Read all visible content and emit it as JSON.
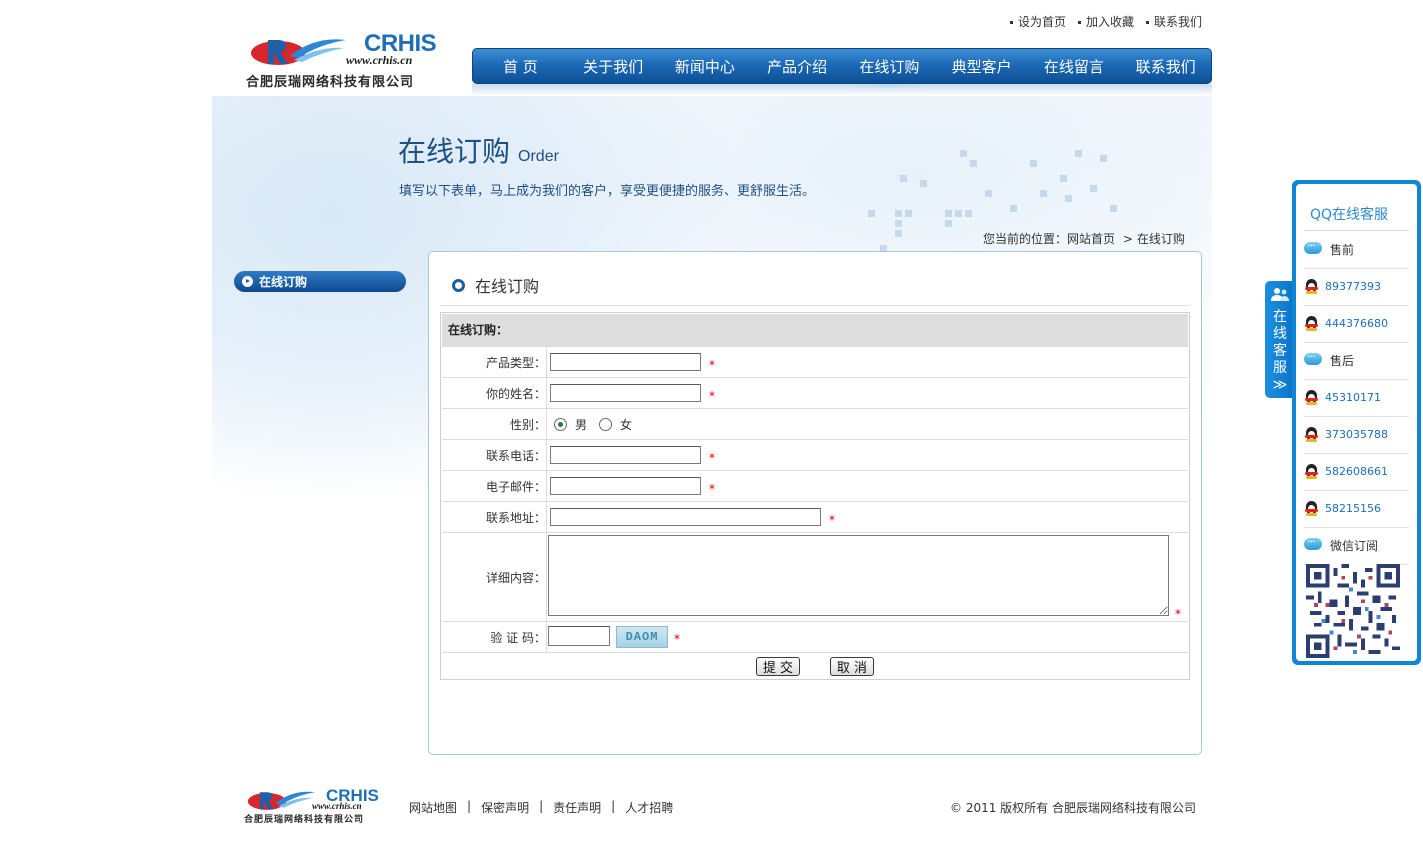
{
  "header": {
    "logo": {
      "brand": "CRHIS",
      "domain": "www.crhis.cn",
      "company": "合肥辰瑞网络科技有限公司"
    },
    "top_links": [
      "设为首页",
      "加入收藏",
      "联系我们"
    ],
    "nav": {
      "items": [
        "首 页",
        "关于我们",
        "新闻中心",
        "产品介绍",
        "在线订购",
        "典型客户",
        "在线留言",
        "联系我们"
      ],
      "active": "在线订购"
    }
  },
  "banner": {
    "title": "在线订购",
    "title_en": "Order",
    "subtitle": "填写以下表单，马上成为我们的客户，享受更便捷的服务、更舒服生活。"
  },
  "breadcrumb": {
    "prefix": "您当前的位置：",
    "home": "网站首页",
    "separator": ">",
    "current": "在线订购"
  },
  "sidebar": {
    "items": [
      "在线订购"
    ]
  },
  "panel": {
    "title": "在线订购"
  },
  "form": {
    "header": "在线订购：",
    "required_mark": "*",
    "fields": {
      "product_type": {
        "label": "产品类型：",
        "value": ""
      },
      "name": {
        "label": "你的姓名：",
        "value": ""
      },
      "gender": {
        "label": "性别：",
        "options": [
          "男",
          "女"
        ],
        "selected": "男"
      },
      "phone": {
        "label": "联系电话：",
        "value": ""
      },
      "email": {
        "label": "电子邮件：",
        "value": ""
      },
      "address": {
        "label": "联系地址：",
        "value": ""
      },
      "details": {
        "label": "详细内容：",
        "value": ""
      },
      "captcha": {
        "label": "验 证 码：",
        "value": "",
        "image_text": "DAOM"
      }
    },
    "submit_label": "提 交",
    "cancel_label": "取 消"
  },
  "footer": {
    "logo": {
      "brand": "CRHIS",
      "domain": "www.crhis.cn",
      "company": "合肥辰瑞网络科技有限公司"
    },
    "links": [
      "网站地图",
      "保密声明",
      "责任声明",
      "人才招聘"
    ],
    "separator": "|",
    "copyright": "© 2011 版权所有 合肥辰瑞网络科技有限公司"
  },
  "qq_widget": {
    "tab_label": [
      "在",
      "线",
      "客",
      "服",
      "≫"
    ],
    "title": "QQ在线客服",
    "rows": [
      {
        "type": "group",
        "text": "售前"
      },
      {
        "type": "qq",
        "text": "89377393"
      },
      {
        "type": "qq",
        "text": "444376680"
      },
      {
        "type": "group",
        "text": "售后"
      },
      {
        "type": "qq",
        "text": "45310171"
      },
      {
        "type": "qq",
        "text": "373035788"
      },
      {
        "type": "qq",
        "text": "582608661"
      },
      {
        "type": "qq",
        "text": "58215156"
      },
      {
        "type": "group",
        "text": "微信订阅"
      }
    ]
  },
  "colors": {
    "nav_blue": "#1c6ab7",
    "title_blue": "#1f4f83",
    "qq_blue": "#0e86d6",
    "required_red": "#cc0000"
  }
}
